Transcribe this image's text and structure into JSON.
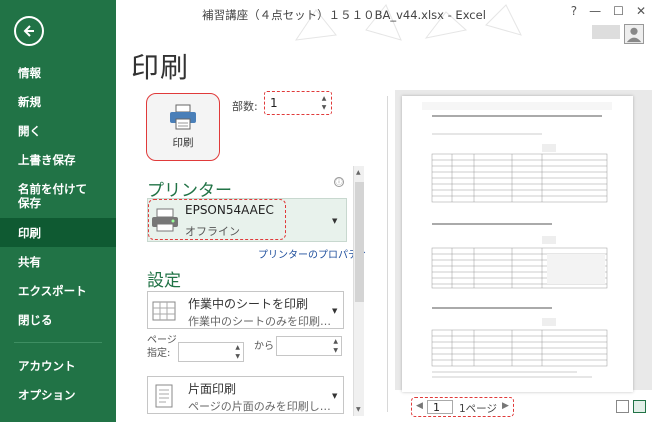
{
  "window": {
    "title": "補習講座（４点セット）１５１０BA_v44.xlsx - Excel",
    "help": "?",
    "minimize": "—",
    "restore": "☐",
    "close": "✕"
  },
  "sidebar": {
    "items": [
      {
        "label": "情報"
      },
      {
        "label": "新規"
      },
      {
        "label": "開く"
      },
      {
        "label": "上書き保存"
      },
      {
        "label": "名前を付けて保存"
      },
      {
        "label": "印刷",
        "active": true
      },
      {
        "label": "共有"
      },
      {
        "label": "エクスポート"
      },
      {
        "label": "閉じる"
      }
    ],
    "bottom": [
      {
        "label": "アカウント"
      },
      {
        "label": "オプション"
      }
    ]
  },
  "print": {
    "title": "印刷",
    "button_label": "印刷",
    "copies_label": "部数:",
    "copies_value": "1"
  },
  "printer": {
    "heading": "プリンター",
    "name": "EPSON54AAEC",
    "status": "オフライン",
    "properties_link": "プリンターのプロパティ",
    "info": "ⓘ"
  },
  "settings": {
    "heading": "設定",
    "what_main": "作業中のシートを印刷",
    "what_sub": "作業中のシートのみを印刷…",
    "pages_label": "ページ指定:",
    "to_label": "から",
    "sides_main": "片面印刷",
    "sides_sub": "ページの片面のみを印刷し…"
  },
  "preview": {
    "current_page": "1",
    "total": "1ページ"
  },
  "colors": {
    "accent": "#217346",
    "highlight": "#e03a3a"
  }
}
